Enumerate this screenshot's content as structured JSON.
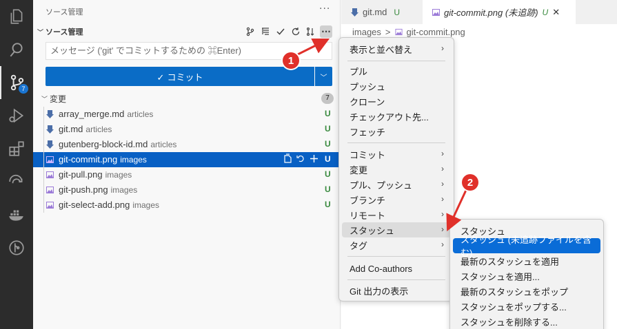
{
  "sidebar": {
    "title": "ソース管理",
    "more": "···",
    "section_title": "ソース管理",
    "commit_message_placeholder": "メッセージ ('git' でコミットするための ⌘Enter)",
    "commit_button": "✓ コミット",
    "changes_label": "変更",
    "changes_count": "7",
    "badge_count": "7",
    "files": [
      {
        "name": "array_merge.md",
        "dir": "articles",
        "status": "U",
        "type": "md"
      },
      {
        "name": "git.md",
        "dir": "articles",
        "status": "U",
        "type": "md"
      },
      {
        "name": "gutenberg-block-id.md",
        "dir": "articles",
        "status": "U",
        "type": "md"
      },
      {
        "name": "git-commit.png",
        "dir": "images",
        "status": "U",
        "type": "png",
        "selected": true
      },
      {
        "name": "git-pull.png",
        "dir": "images",
        "status": "U",
        "type": "png"
      },
      {
        "name": "git-push.png",
        "dir": "images",
        "status": "U",
        "type": "png"
      },
      {
        "name": "git-select-add.png",
        "dir": "images",
        "status": "U",
        "type": "png"
      }
    ]
  },
  "tabs": [
    {
      "label": "git.md",
      "status": "U"
    },
    {
      "label": "git-commit.png (未追跡)",
      "status": "U",
      "active": true
    }
  ],
  "breadcrumb": {
    "folder": "images",
    "separator": ">",
    "file": "git-commit.png"
  },
  "menu": {
    "items": [
      "表示と並べ替え",
      "プル",
      "プッシュ",
      "クローン",
      "チェックアウト先...",
      "フェッチ",
      "コミット",
      "変更",
      "プル、プッシュ",
      "ブランチ",
      "リモート",
      "スタッシュ",
      "タグ",
      "Add Co-authors",
      "Git 出力の表示"
    ]
  },
  "submenu": {
    "items": [
      "スタッシュ",
      "スタッシュ (未追跡ファイルを含む)",
      "最新のスタッシュを適用",
      "スタッシュを適用...",
      "最新のスタッシュをポップ",
      "スタッシュをポップする...",
      "スタッシュを削除する..."
    ]
  },
  "annotations": {
    "step1": "1",
    "step2": "2"
  },
  "colors": {
    "accent": "#0a6cc6",
    "selection": "#0860c4",
    "annotation": "#e0302a",
    "untracked": "#3a8a3f"
  }
}
